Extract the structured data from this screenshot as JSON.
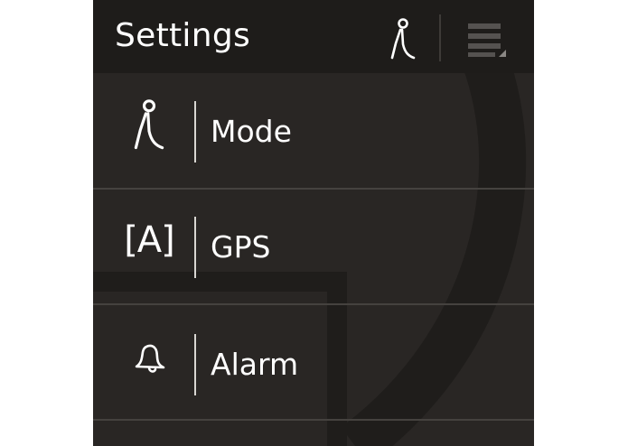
{
  "header": {
    "title": "Settings",
    "mode_icon": "walking-person-icon",
    "menu_icon": "hamburger-menu-icon"
  },
  "menu": {
    "items": [
      {
        "label": "Mode",
        "icon": "walking-person-icon"
      },
      {
        "label": "GPS",
        "icon": "gps-auto-icon",
        "icon_text": "[A]"
      },
      {
        "label": "Alarm",
        "icon": "bell-icon"
      }
    ]
  },
  "colors": {
    "background": "#292624",
    "header_bg": "#1e1c1a",
    "text": "#ffffff"
  }
}
